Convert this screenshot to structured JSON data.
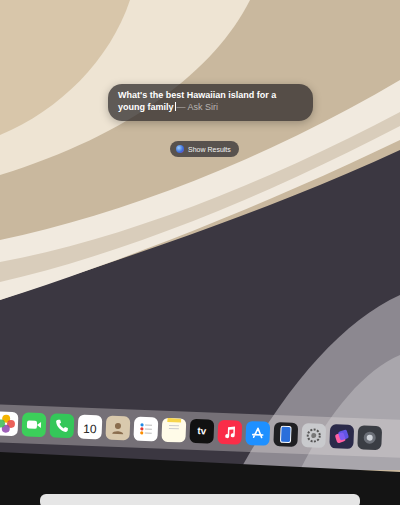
{
  "siri_panel": {
    "query": "What's the best Hawaiian island for a young family",
    "hint": "— Ask Siri"
  },
  "show_results_button": {
    "label": "Show Results"
  },
  "dock": {
    "items": [
      {
        "kind": "photos",
        "text": ""
      },
      {
        "kind": "facetime",
        "text": ""
      },
      {
        "kind": "phone",
        "text": ""
      },
      {
        "kind": "calendar",
        "text": "10"
      },
      {
        "kind": "contacts",
        "text": ""
      },
      {
        "kind": "reminders",
        "text": ""
      },
      {
        "kind": "notes",
        "text": ""
      },
      {
        "kind": "tv",
        "text": "tv"
      },
      {
        "kind": "music",
        "text": ""
      },
      {
        "kind": "appstore",
        "text": ""
      },
      {
        "kind": "mirroring",
        "text": ""
      },
      {
        "kind": "settings",
        "text": ""
      },
      {
        "kind": "shortcuts",
        "text": ""
      },
      {
        "kind": "other",
        "text": ""
      }
    ]
  }
}
